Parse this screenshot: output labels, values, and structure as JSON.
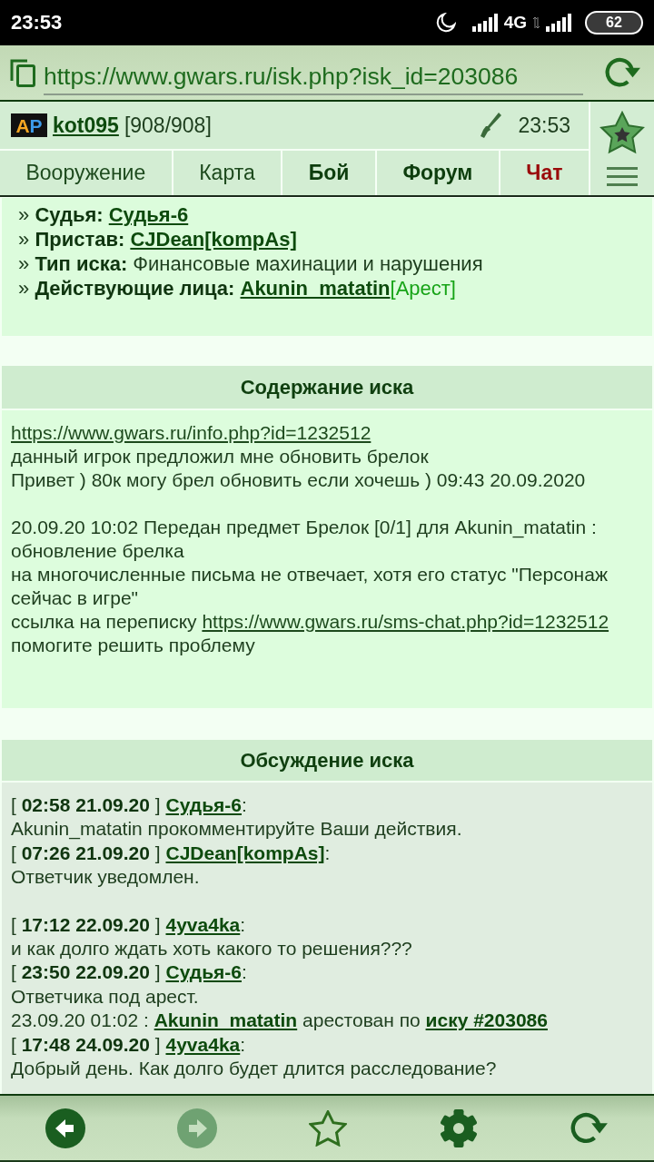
{
  "status_bar": {
    "time": "23:53",
    "network": "4G",
    "battery": "62"
  },
  "address_bar": {
    "url": "https://www.gwars.ru/isk.php?isk_id=203086"
  },
  "header": {
    "logo": [
      {
        "text": "A",
        "color": "#f5a623"
      },
      {
        "text": "P",
        "color": "#3d9be9"
      }
    ],
    "user": "kot095",
    "hp": "[908/908]",
    "clock": "23:53",
    "tabs": [
      {
        "label": "Вооружение",
        "kind": "plain"
      },
      {
        "label": "Карта",
        "kind": "plain"
      },
      {
        "label": "Бой",
        "kind": "bold"
      },
      {
        "label": "Форум",
        "kind": "bold"
      },
      {
        "label": "Чат",
        "kind": "alert"
      }
    ]
  },
  "case_info": [
    {
      "marker": "»",
      "label": "Судья:",
      "link": "Судья-6"
    },
    {
      "marker": "»",
      "label": "Пристав:",
      "link": "CJDean[kompAs]"
    },
    {
      "marker": "»",
      "label": "Тип иска:",
      "value": "Финансовые махинации и нарушения"
    },
    {
      "marker": "»",
      "label": "Действующие лица:",
      "link": "Akunin_matatin",
      "status": "[Арест]"
    }
  ],
  "complaint": {
    "title": "Содержание иска",
    "lines": [
      {
        "kind": "line",
        "parts": [
          {
            "kind": "url_link",
            "text": "https://www.gwars.ru/info.php?id=1232512"
          }
        ]
      },
      {
        "kind": "line",
        "parts": [
          {
            "kind": "text",
            "text": "данный игрок предложил мне обновить брелок"
          }
        ]
      },
      {
        "kind": "line",
        "parts": [
          {
            "kind": "text",
            "text": "Привет ) 80к могу брел обновить если хочешь ) 09:43 20.09.2020"
          }
        ]
      },
      {
        "kind": "blank"
      },
      {
        "kind": "line",
        "parts": [
          {
            "kind": "text",
            "text": "20.09.20 10:02 Передан предмет Брелок [0/1] для Akunin_matatin : обновление брелка"
          }
        ]
      },
      {
        "kind": "line",
        "parts": [
          {
            "kind": "text",
            "text": "на многочисленные письма не отвечает, хотя его статус \"Персонаж сейчас в игре\""
          }
        ]
      },
      {
        "kind": "line",
        "parts": [
          {
            "kind": "text",
            "text": "ссылка на переписку"
          },
          {
            "kind": "url_link",
            "text": "https://www.gwars.ru/sms-chat.php?id=1232512"
          }
        ]
      },
      {
        "kind": "line",
        "parts": [
          {
            "kind": "text",
            "text": "помогите решить проблему"
          }
        ]
      }
    ]
  },
  "discussion": {
    "title": "Обсуждение иска",
    "entries": [
      {
        "kind": "comment",
        "stamp": "[ **02:58 21.09.20** ]",
        "author": "Судья-6",
        "suffix": ":",
        "text": "Akunin_matatin прокомментируйте Ваши действия."
      },
      {
        "kind": "comment",
        "stamp": "[ **07:26 21.09.20** ]",
        "author": "CJDean[kompAs]",
        "suffix": ":",
        "text": "Ответчик уведомлен."
      },
      {
        "kind": "blank"
      },
      {
        "kind": "comment",
        "stamp": "[ **17:12 22.09.20** ]",
        "author": "4yva4ka",
        "suffix": ":",
        "text": "и как долго ждать хоть какого то решения???"
      },
      {
        "kind": "comment",
        "stamp": "[ **23:50 22.09.20** ]",
        "author": "Судья-6",
        "suffix": ":",
        "text": "Ответчика под арест."
      },
      {
        "kind": "line",
        "parts": [
          {
            "kind": "text",
            "text": "23.09.20 01:02 :"
          },
          {
            "kind": "player_link",
            "text": "Akunin_matatin"
          },
          {
            "kind": "text",
            "text": "арестован по"
          },
          {
            "kind": "case_link",
            "text": "иску #203086"
          }
        ]
      },
      {
        "kind": "comment",
        "stamp": "[ **17:48 24.09.20** ]",
        "author": "4yva4ka",
        "suffix": ":",
        "text": "Добрый день. Как долго будет длится расследование?"
      }
    ]
  },
  "bottom_bar": [
    {
      "kind": "back",
      "disabled": false
    },
    {
      "kind": "forward",
      "disabled": true
    },
    {
      "kind": "bookmark",
      "disabled": false
    },
    {
      "kind": "settings",
      "disabled": false
    },
    {
      "kind": "reload",
      "disabled": false
    }
  ]
}
